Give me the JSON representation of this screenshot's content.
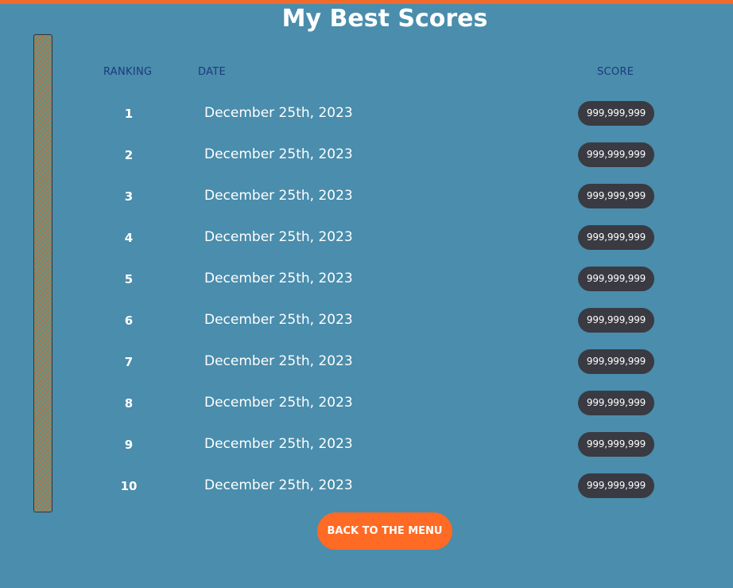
{
  "title": "My Best Scores",
  "headers": {
    "ranking": "RANKING",
    "date": "DATE",
    "score": "SCORE"
  },
  "rows": [
    {
      "rank": "1",
      "date": "December 25th, 2023",
      "score": "999,999,999"
    },
    {
      "rank": "2",
      "date": "December 25th, 2023",
      "score": "999,999,999"
    },
    {
      "rank": "3",
      "date": "December 25th, 2023",
      "score": "999,999,999"
    },
    {
      "rank": "4",
      "date": "December 25th, 2023",
      "score": "999,999,999"
    },
    {
      "rank": "5",
      "date": "December 25th, 2023",
      "score": "999,999,999"
    },
    {
      "rank": "6",
      "date": "December 25th, 2023",
      "score": "999,999,999"
    },
    {
      "rank": "7",
      "date": "December 25th, 2023",
      "score": "999,999,999"
    },
    {
      "rank": "8",
      "date": "December 25th, 2023",
      "score": "999,999,999"
    },
    {
      "rank": "9",
      "date": "December 25th, 2023",
      "score": "999,999,999"
    },
    {
      "rank": "10",
      "date": "December 25th, 2023",
      "score": "999,999,999"
    }
  ],
  "back_button": "BACK TO THE MENU",
  "colors": {
    "background": "#4a8dac",
    "accent": "#ff6a24",
    "header_text": "#1d3a7e",
    "badge": "#3a3a42"
  }
}
